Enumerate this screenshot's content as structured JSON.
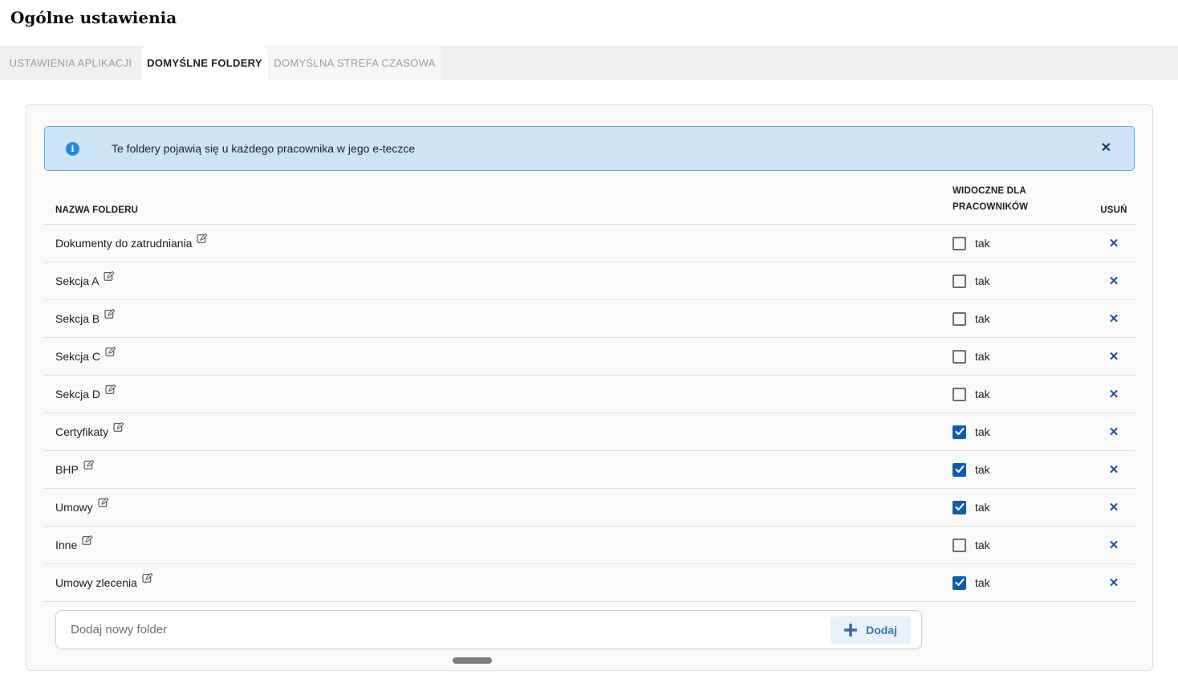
{
  "page": {
    "title": "Ogólne ustawienia"
  },
  "tabs": [
    {
      "label": "USTAWIENIA APLIKACJI",
      "active": false
    },
    {
      "label": "DOMYŚLNE FOLDERY",
      "active": true
    },
    {
      "label": "DOMYŚLNA STREFA CZASOWA",
      "active": false
    }
  ],
  "banner": {
    "text": "Te foldery pojawią się u każdego pracownika w jego e-teczce"
  },
  "icons": {
    "info": "i",
    "close": "✕",
    "delete": "✕"
  },
  "table": {
    "headers": {
      "name": "NAZWA FOLDERU",
      "visible_line1": "WIDOCZNE DLA",
      "visible_line2": "PRACOWNIKÓW",
      "delete": "USUŃ"
    },
    "checkbox_label": "tak",
    "rows": [
      {
        "name": "Dokumenty do zatrudniania",
        "visible": false
      },
      {
        "name": "Sekcja A",
        "visible": false
      },
      {
        "name": "Sekcja B",
        "visible": false
      },
      {
        "name": "Sekcja C",
        "visible": false
      },
      {
        "name": "Sekcja D",
        "visible": false
      },
      {
        "name": "Certyfikaty",
        "visible": true
      },
      {
        "name": "BHP",
        "visible": true
      },
      {
        "name": "Umowy",
        "visible": true
      },
      {
        "name": "Inne",
        "visible": false
      },
      {
        "name": "Umowy zlecenia",
        "visible": true
      }
    ]
  },
  "add_folder": {
    "placeholder": "Dodaj nowy folder",
    "button_label": "Dodaj"
  },
  "colors": {
    "accent_blue": "#0f5dab",
    "banner_bg": "#cee4f6",
    "banner_border": "#65a9e0",
    "info_icon": "#2488dd",
    "delete_x": "#1d4f9e",
    "button_bg": "#e9f1fb",
    "button_text": "#3f6fb5"
  }
}
